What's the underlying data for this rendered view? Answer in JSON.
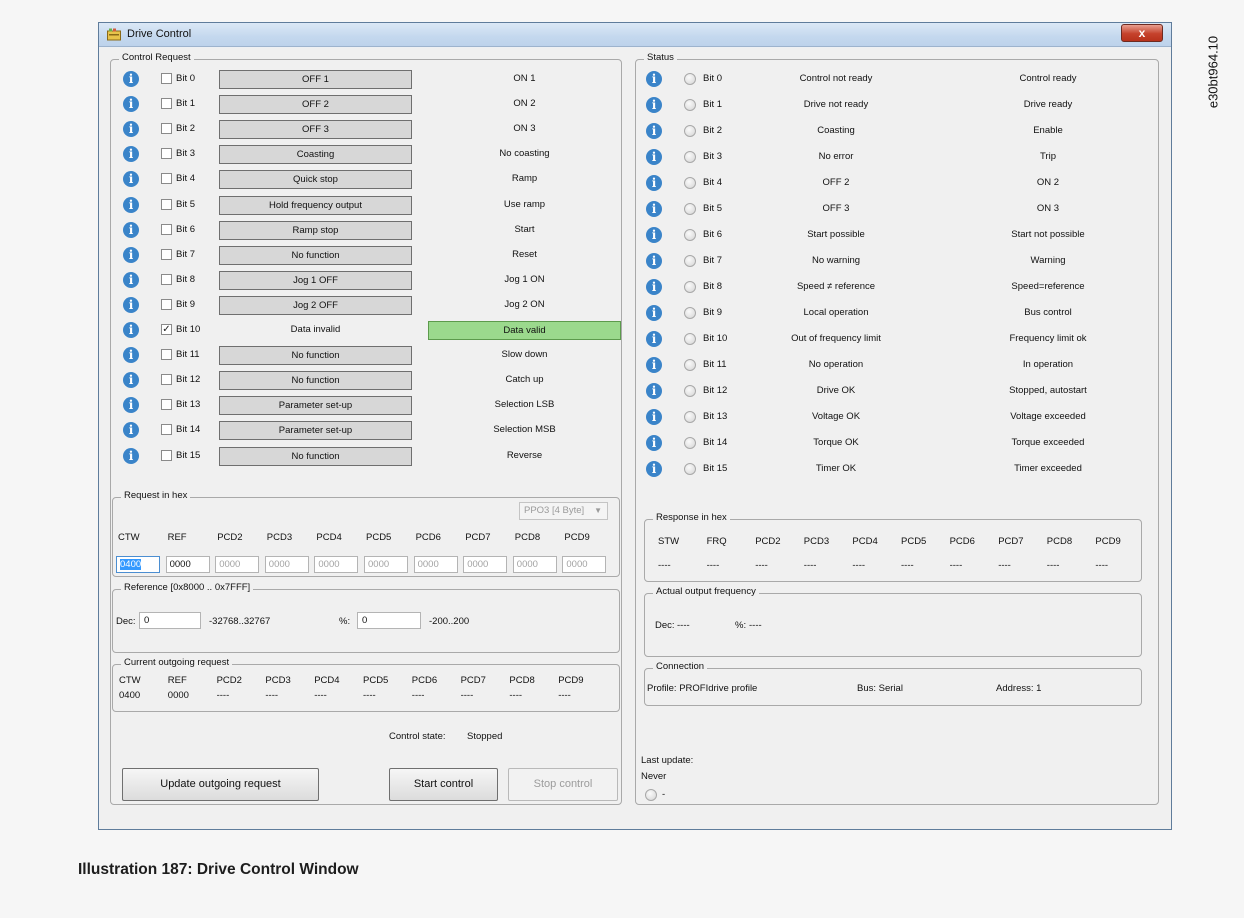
{
  "window": {
    "title": "Drive Control",
    "close_glyph": "x"
  },
  "doc_id": "e30bt964.10",
  "caption": "Illustration 187: Drive Control Window",
  "control_request": {
    "title": "Control Request",
    "rows": [
      {
        "bit": "Bit 0",
        "checked": false,
        "off": "OFF 1",
        "on": "ON 1"
      },
      {
        "bit": "Bit 1",
        "checked": false,
        "off": "OFF 2",
        "on": "ON 2"
      },
      {
        "bit": "Bit 2",
        "checked": false,
        "off": "OFF 3",
        "on": "ON 3"
      },
      {
        "bit": "Bit 3",
        "checked": false,
        "off": "Coasting",
        "on": "No coasting"
      },
      {
        "bit": "Bit 4",
        "checked": false,
        "off": "Quick stop",
        "on": "Ramp"
      },
      {
        "bit": "Bit 5",
        "checked": false,
        "off": "Hold frequency output",
        "on": "Use ramp"
      },
      {
        "bit": "Bit 6",
        "checked": false,
        "off": "Ramp stop",
        "on": "Start"
      },
      {
        "bit": "Bit 7",
        "checked": false,
        "off": "No function",
        "on": "Reset"
      },
      {
        "bit": "Bit 8",
        "checked": false,
        "off": "Jog 1 OFF",
        "on": "Jog 1 ON"
      },
      {
        "bit": "Bit 9",
        "checked": false,
        "off": "Jog 2 OFF",
        "on": "Jog 2 ON"
      },
      {
        "bit": "Bit 10",
        "checked": true,
        "off": "Data invalid",
        "on": "Data valid"
      },
      {
        "bit": "Bit 11",
        "checked": false,
        "off": "No function",
        "on": "Slow down"
      },
      {
        "bit": "Bit 12",
        "checked": false,
        "off": "No function",
        "on": "Catch up"
      },
      {
        "bit": "Bit 13",
        "checked": false,
        "off": "Parameter set-up",
        "on": "Selection LSB"
      },
      {
        "bit": "Bit 14",
        "checked": false,
        "off": "Parameter set-up",
        "on": "Selection MSB"
      },
      {
        "bit": "Bit 15",
        "checked": false,
        "off": "No function",
        "on": "Reverse"
      }
    ]
  },
  "status": {
    "title": "Status",
    "rows": [
      {
        "bit": "Bit 0",
        "off": "Control not ready",
        "on": "Control ready"
      },
      {
        "bit": "Bit 1",
        "off": "Drive not ready",
        "on": "Drive ready"
      },
      {
        "bit": "Bit 2",
        "off": "Coasting",
        "on": "Enable"
      },
      {
        "bit": "Bit 3",
        "off": "No error",
        "on": "Trip"
      },
      {
        "bit": "Bit 4",
        "off": "OFF 2",
        "on": "ON 2"
      },
      {
        "bit": "Bit 5",
        "off": "OFF 3",
        "on": "ON 3"
      },
      {
        "bit": "Bit 6",
        "off": "Start possible",
        "on": "Start not possible"
      },
      {
        "bit": "Bit 7",
        "off": "No warning",
        "on": "Warning"
      },
      {
        "bit": "Bit 8",
        "off": "Speed ≠ reference",
        "on": "Speed=reference"
      },
      {
        "bit": "Bit 9",
        "off": "Local operation",
        "on": "Bus control"
      },
      {
        "bit": "Bit 10",
        "off": "Out of frequency limit",
        "on": "Frequency limit ok"
      },
      {
        "bit": "Bit 11",
        "off": "No operation",
        "on": "In operation"
      },
      {
        "bit": "Bit 12",
        "off": "Drive OK",
        "on": "Stopped, autostart"
      },
      {
        "bit": "Bit 13",
        "off": "Voltage OK",
        "on": "Voltage exceeded"
      },
      {
        "bit": "Bit 14",
        "off": "Torque OK",
        "on": "Torque exceeded"
      },
      {
        "bit": "Bit 15",
        "off": "Timer OK",
        "on": "Timer exceeded"
      }
    ]
  },
  "request_hex": {
    "title": "Request in hex",
    "ppo": "PPO3 [4 Byte]",
    "headers": [
      "CTW",
      "REF",
      "PCD2",
      "PCD3",
      "PCD4",
      "PCD5",
      "PCD6",
      "PCD7",
      "PCD8",
      "PCD9"
    ],
    "values": [
      "0400",
      "0000",
      "0000",
      "0000",
      "0000",
      "0000",
      "0000",
      "0000",
      "0000",
      "0000"
    ]
  },
  "reference": {
    "title": "Reference [0x8000 .. 0x7FFF]",
    "dec_label": "Dec:",
    "dec_value": "0",
    "dec_range": "-32768..32767",
    "pct_label": "%:",
    "pct_value": "0",
    "pct_range": "-200..200"
  },
  "outgoing": {
    "title": "Current outgoing request",
    "headers": [
      "CTW",
      "REF",
      "PCD2",
      "PCD3",
      "PCD4",
      "PCD5",
      "PCD6",
      "PCD7",
      "PCD8",
      "PCD9"
    ],
    "values": [
      "0400",
      "0000",
      "----",
      "----",
      "----",
      "----",
      "----",
      "----",
      "----",
      "----"
    ]
  },
  "control_state": {
    "label": "Control state:",
    "value": "Stopped"
  },
  "buttons": {
    "update": "Update outgoing request",
    "start": "Start control",
    "stop": "Stop control"
  },
  "response_hex": {
    "title": "Response in hex",
    "headers": [
      "STW",
      "FRQ",
      "PCD2",
      "PCD3",
      "PCD4",
      "PCD5",
      "PCD6",
      "PCD7",
      "PCD8",
      "PCD9"
    ],
    "values": [
      "----",
      "----",
      "----",
      "----",
      "----",
      "----",
      "----",
      "----",
      "----",
      "----"
    ]
  },
  "actual_freq": {
    "title": "Actual output frequency",
    "dec_label": "Dec:",
    "dec_value": "----",
    "pct_label": "%:",
    "pct_value": "----"
  },
  "connection": {
    "title": "Connection",
    "profile": "Profile:  PROFIdrive profile",
    "bus": "Bus:  Serial",
    "address": "Address:  1"
  },
  "last_update": {
    "label": "Last update:",
    "value": "Never",
    "indicator_text": "-"
  },
  "colors": {
    "info": "#3a84c9",
    "data_valid": "#9bd98d",
    "title_bar": "#c4d8ee",
    "close": "#c5412b"
  },
  "icons": {
    "info": "info-icon",
    "app": "app-icon",
    "close": "close-icon"
  }
}
